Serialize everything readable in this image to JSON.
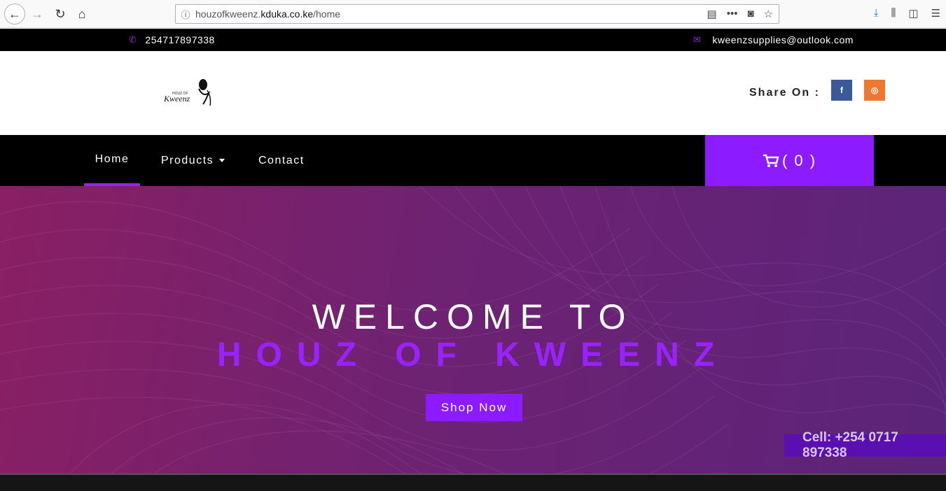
{
  "browser": {
    "url_prefix": "houzofkweenz.",
    "url_domain": "kduka.co.ke",
    "url_path": "/home"
  },
  "topbar": {
    "phone": "254717897338",
    "email": "kweenzsupplies@outlook.com"
  },
  "header": {
    "logo_top": "HOUZ OF",
    "logo_script": "Kweenz",
    "share_label": "Share On :",
    "facebook_glyph": "f",
    "instagram_glyph": "◎"
  },
  "nav": {
    "home": "Home",
    "products": "Products",
    "contact": "Contact",
    "cart_count": "( 0 )"
  },
  "hero": {
    "line1": "WELCOME TO",
    "line2": "HOUZ OF KWEENZ",
    "button": "Shop Now",
    "cell": "Cell: +254 0717 897338"
  },
  "colors": {
    "accent": "#8c1bff",
    "facebook": "#3b5998",
    "instagram": "#f0772f"
  }
}
